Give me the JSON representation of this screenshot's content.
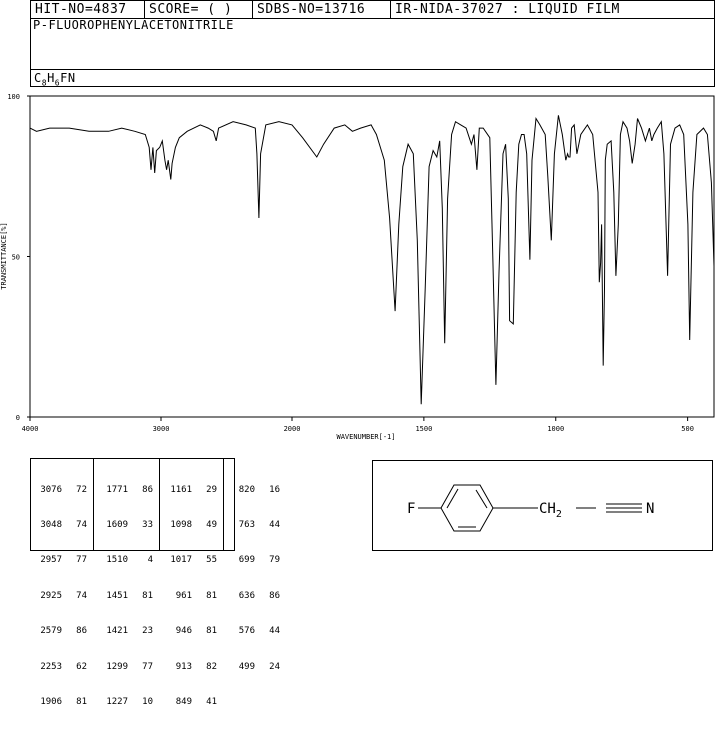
{
  "header": {
    "hit_no": "HIT-NO=4837",
    "score": "SCORE=  (   )",
    "sdbs_no": "SDBS-NO=13716",
    "ir_nida": "IR-NIDA-37027 : LIQUID FILM"
  },
  "compound": {
    "name": "P-FLUOROPHENYLACETONITRILE",
    "formula_parts": [
      "C",
      "8",
      "H",
      "6",
      "FN"
    ]
  },
  "chart_data": {
    "type": "line",
    "title": "",
    "xlabel": "WAVENUMBER[-1]",
    "ylabel": "TRANSMITTANCE[%]",
    "xlim": [
      4000,
      400
    ],
    "ylim": [
      0,
      100
    ],
    "x_ticks": [
      4000,
      3000,
      2000,
      1500,
      1000,
      500
    ],
    "x_tick_labels": [
      "4000",
      "3000",
      "2000",
      "1500",
      "1000",
      "500"
    ],
    "y_ticks": [
      0,
      50,
      100
    ],
    "y_tick_labels": [
      "0",
      "50",
      "100"
    ],
    "grid": false,
    "series": [
      {
        "name": "",
        "x": [
          4000,
          3950,
          3850,
          3700,
          3550,
          3400,
          3300,
          3200,
          3120,
          3090,
          3076,
          3062,
          3048,
          3035,
          3010,
          2990,
          2970,
          2957,
          2945,
          2925,
          2915,
          2890,
          2860,
          2800,
          2700,
          2640,
          2600,
          2579,
          2560,
          2450,
          2350,
          2280,
          2268,
          2253,
          2240,
          2200,
          2100,
          2000,
          1960,
          1906,
          1880,
          1840,
          1800,
          1771,
          1740,
          1700,
          1680,
          1650,
          1630,
          1609,
          1595,
          1580,
          1560,
          1540,
          1525,
          1510,
          1495,
          1480,
          1465,
          1451,
          1440,
          1430,
          1421,
          1410,
          1395,
          1380,
          1360,
          1340,
          1320,
          1310,
          1299,
          1290,
          1275,
          1250,
          1240,
          1227,
          1215,
          1200,
          1190,
          1180,
          1175,
          1161,
          1150,
          1140,
          1130,
          1120,
          1110,
          1098,
          1090,
          1075,
          1060,
          1040,
          1030,
          1017,
          1005,
          990,
          975,
          962,
          955,
          951,
          946,
          940,
          930,
          920,
          905,
          880,
          860,
          840,
          835,
          830,
          826,
          820,
          815,
          812,
          805,
          790,
          780,
          772,
          763,
          755,
          745,
          730,
          720,
          710,
          699,
          690,
          675,
          660,
          645,
          636,
          628,
          615,
          600,
          590,
          576,
          565,
          548,
          530,
          515,
          499,
          492,
          480,
          465,
          440,
          425,
          410,
          400
        ],
        "y": [
          90,
          89,
          90,
          90,
          89,
          89,
          90,
          89,
          88,
          84,
          77,
          84,
          76,
          83,
          84,
          86,
          80,
          77,
          80,
          74,
          79,
          84,
          87,
          89,
          91,
          90,
          89,
          86,
          90,
          92,
          91,
          90,
          82,
          62,
          82,
          91,
          92,
          91,
          87,
          81,
          85,
          90,
          91,
          89,
          90,
          91,
          88,
          80,
          62,
          33,
          60,
          78,
          85,
          82,
          55,
          4,
          40,
          78,
          83,
          81,
          86,
          65,
          23,
          68,
          88,
          92,
          91,
          90,
          85,
          88,
          77,
          90,
          90,
          87,
          55,
          10,
          45,
          82,
          85,
          68,
          30,
          29,
          70,
          85,
          88,
          88,
          82,
          49,
          80,
          93,
          91,
          88,
          75,
          55,
          82,
          94,
          88,
          80,
          82,
          81,
          81,
          90,
          91,
          82,
          88,
          91,
          88,
          70,
          42,
          48,
          60,
          16,
          40,
          80,
          85,
          86,
          70,
          44,
          60,
          88,
          92,
          90,
          86,
          79,
          85,
          93,
          90,
          86,
          90,
          86,
          88,
          90,
          92,
          82,
          44,
          85,
          90,
          91,
          88,
          60,
          24,
          70,
          88,
          90,
          88,
          73,
          47
        ]
      }
    ]
  },
  "peak_table": {
    "columns": [
      {
        "wn": [
          "3076",
          "3048",
          "2957",
          "2925",
          "2579",
          "2253",
          "1906"
        ],
        "t": [
          "72",
          "74",
          "77",
          "74",
          "86",
          "62",
          "81"
        ]
      },
      {
        "wn": [
          "1771",
          "1609",
          "1510",
          "1451",
          "1421",
          "1299",
          "1227"
        ],
        "t": [
          "86",
          "33",
          "4",
          "81",
          "23",
          "77",
          "10"
        ]
      },
      {
        "wn": [
          "1161",
          "1098",
          "1017",
          "961",
          "946",
          "913",
          "849"
        ],
        "t": [
          "29",
          "49",
          "55",
          "81",
          "81",
          "82",
          "41"
        ]
      },
      {
        "wn": [
          "820",
          "763",
          "699",
          "636",
          "576",
          "499"
        ],
        "t": [
          "16",
          "44",
          "79",
          "86",
          "44",
          "24"
        ]
      }
    ]
  },
  "structure": {
    "fluoro": "F",
    "ch2_base": "CH",
    "ch2_sub": "2",
    "nitrogen": "N"
  }
}
